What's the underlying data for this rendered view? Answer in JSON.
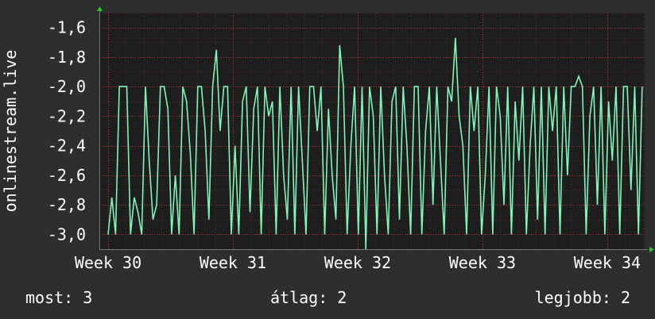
{
  "chart_data": {
    "type": "line",
    "title": "",
    "xlabel": "",
    "ylabel": "onlinestream.live",
    "ylim": [
      -3.1,
      -1.5
    ],
    "y_ticks": [
      -3.0,
      -2.8,
      -2.6,
      -2.4,
      -2.2,
      -2.0,
      -1.8,
      -1.6
    ],
    "y_tick_labels": [
      "-3,0",
      "-2,8",
      "-2,6",
      "-2,4",
      "-2,2",
      "-2,0",
      "-1,8",
      "-1,6"
    ],
    "x_ticks": [
      30,
      31,
      32,
      33,
      34
    ],
    "x_tick_labels": [
      "Week 30",
      "Week 31",
      "Week 32",
      "Week 33",
      "Week 34"
    ],
    "xlim": [
      29.93,
      34.3
    ],
    "grid": true,
    "colors": {
      "background": "#2e2e2e",
      "plot_background": "#1e1e1e",
      "grid": "#b53a3a",
      "line": "#7ff5b8",
      "axis_arrow": "#22cc22",
      "text": "#ffffff"
    },
    "series": [
      {
        "x_start": 30.0,
        "x_end": 34.28,
        "values": [
          -3.0,
          -2.75,
          -3.0,
          -2.0,
          -2.0,
          -2.0,
          -3.0,
          -2.75,
          -2.85,
          -3.0,
          -2.0,
          -2.5,
          -2.9,
          -2.8,
          -2.0,
          -2.0,
          -2.15,
          -3.0,
          -2.6,
          -3.0,
          -2.0,
          -2.1,
          -2.45,
          -3.0,
          -2.0,
          -2.0,
          -2.3,
          -2.9,
          -2.0,
          -1.75,
          -2.3,
          -2.0,
          -2.0,
          -3.0,
          -2.4,
          -3.0,
          -2.1,
          -2.0,
          -2.85,
          -2.15,
          -2.0,
          -3.0,
          -2.0,
          -2.2,
          -2.1,
          -3.0,
          -2.0,
          -2.6,
          -2.9,
          -2.0,
          -3.0,
          -2.0,
          -2.5,
          -3.0,
          -2.0,
          -2.0,
          -2.3,
          -2.0,
          -3.0,
          -2.15,
          -2.6,
          -2.9,
          -1.72,
          -2.0,
          -3.0,
          -2.4,
          -2.0,
          -3.0,
          -2.0,
          -3.1,
          -2.0,
          -2.2,
          -3.0,
          -2.0,
          -2.6,
          -3.0,
          -2.1,
          -2.0,
          -2.9,
          -2.0,
          -2.4,
          -3.0,
          -2.0,
          -2.0,
          -3.0,
          -2.3,
          -2.0,
          -2.8,
          -2.0,
          -2.5,
          -3.0,
          -2.0,
          -2.1,
          -1.67,
          -2.2,
          -2.4,
          -3.0,
          -2.0,
          -2.3,
          -2.0,
          -3.0,
          -2.6,
          -2.0,
          -3.0,
          -2.0,
          -2.2,
          -2.8,
          -2.0,
          -3.0,
          -2.1,
          -2.5,
          -2.0,
          -3.0,
          -2.4,
          -2.0,
          -2.9,
          -2.0,
          -3.0,
          -2.0,
          -2.3,
          -2.0,
          -3.0,
          -2.0,
          -2.6,
          -2.0,
          -2.0,
          -1.93,
          -2.0,
          -3.0,
          -2.2,
          -2.0,
          -2.8,
          -2.0,
          -3.0,
          -2.1,
          -2.5,
          -2.0,
          -3.0,
          -2.0,
          -2.0,
          -2.7,
          -2.0,
          -3.0,
          -2.0
        ]
      }
    ]
  },
  "stats": {
    "current": "most: 3",
    "average": "átlag: 2",
    "best": "legjobb: 2"
  }
}
